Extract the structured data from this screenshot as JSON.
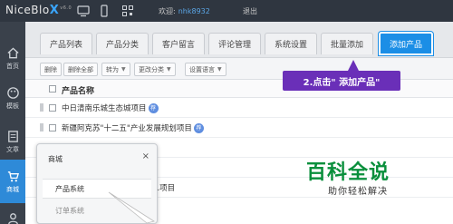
{
  "header": {
    "logo_prefix": "NiceBlo",
    "logo_x": "X",
    "logo_version": "v6.0",
    "welcome": "欢迎:",
    "username": "nhk8932",
    "logout": "退出"
  },
  "sidebar": {
    "items": [
      {
        "label": "首页",
        "icon": "home-icon"
      },
      {
        "label": "模板",
        "icon": "palette-icon"
      },
      {
        "label": "文章",
        "icon": "article-icon"
      },
      {
        "label": "商城",
        "icon": "cart-icon"
      },
      {
        "label": "",
        "icon": "users-icon"
      }
    ]
  },
  "tabs": [
    "产品列表",
    "产品分类",
    "客户留言",
    "评论管理",
    "系统设置",
    "批量添加",
    "添加产品"
  ],
  "toolbar": {
    "delete": "删除",
    "delete_all": "删除全部",
    "move_to": "转为",
    "change_category": "更改分类",
    "set_language": "设置语言"
  },
  "table": {
    "header": "产品名称",
    "rows": [
      {
        "name": "中日清南乐城生态城项目",
        "badge": "荐"
      },
      {
        "name": "新疆阿克苏\"十二五\"产业发展规划项目",
        "badge": "荐"
      },
      {
        "name": "",
        "badge": ""
      },
      {
        "name": "",
        "badge": ""
      },
      {
        "name": "...项目",
        "badge": ""
      }
    ]
  },
  "callout": "2.点击\" 添加产品\"",
  "popup": {
    "title": "商城",
    "close": "×",
    "items": [
      "产品系统",
      "订单系统"
    ]
  },
  "watermark": {
    "big": "百科全说",
    "small": "助你轻松解决"
  },
  "colors": {
    "accent": "#1b8ee6",
    "callout": "#6a2fb8",
    "watermark": "#0a8f3c"
  }
}
